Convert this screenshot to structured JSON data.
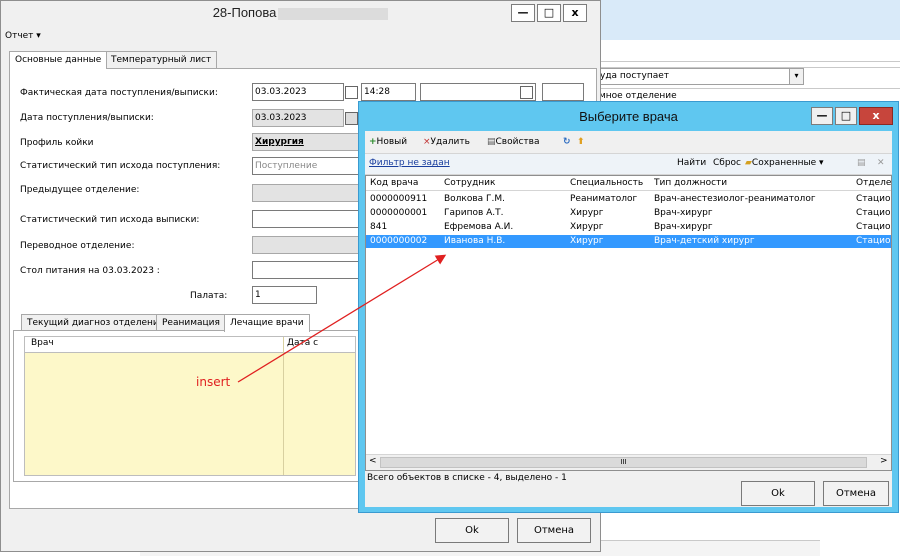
{
  "background_app": {
    "combo_value": "уда поступает",
    "row2_text": "мное отделение",
    "combo_arrow": "chevron-down-icon"
  },
  "main_window": {
    "title": "28-Попова",
    "btn_min": "—",
    "btn_max": "□",
    "btn_close": "x",
    "menu_report": "Отчет ▾",
    "tabs": [
      "Основные данные",
      "Температурный лист"
    ],
    "fields": {
      "fact_date_label": "Фактическая дата поступления/выписки:",
      "fact_date_value": "03.03.2023",
      "fact_time_value": "14:28",
      "admit_date_label": "Дата поступления/выписки:",
      "admit_date_value": "03.03.2023",
      "bed_profile_label": "Профиль койки",
      "bed_profile_value": "Хирургия",
      "stat_type_in_label": "Статистический тип исхода поступления:",
      "stat_type_in_placeholder": "Поступление",
      "prev_dept_label": "Предыдущее отделение:",
      "stat_type_out_label": "Статистический тип исхода выписки:",
      "transfer_dept_label": "Переводное отделение:",
      "diet_label": "Стол питания на 03.03.2023 :",
      "ward_label": "Палата:",
      "ward_value": "1"
    },
    "lower_tabs": [
      "Текущий диагноз отделения",
      "Реанимация",
      "Лечащие врачи"
    ],
    "grid_columns": [
      "Врач",
      "Дата с"
    ],
    "ok": "Ok",
    "cancel": "Отмена"
  },
  "dialog": {
    "title": "Выберите врача",
    "btn_min": "—",
    "btn_max": "□",
    "btn_close": "x",
    "toolbar": {
      "new": "Новый",
      "delete": "Удалить",
      "properties": "Свойства",
      "find": "Найти",
      "reset": "Сброс",
      "saved": "Сохраненные ▾",
      "close": "✕"
    },
    "filter_link": "Фильтр не задан",
    "columns": [
      "Код врача",
      "Сотрудник",
      "Специальность",
      "Тип должности",
      "Отделе"
    ],
    "rows": [
      [
        "0000000911",
        "Волкова Г.М.",
        "Реаниматолог",
        "Врач-анестезиолог-реаниматолог",
        "Стацио"
      ],
      [
        "0000000001",
        "Гарипов А.Т.",
        "Хирург",
        "Врач-хирург",
        "Стацио"
      ],
      [
        "841",
        "Ефремова А.И.",
        "Хирург",
        "Врач-хирург",
        "Стацио"
      ],
      [
        "0000000002",
        "Иванова Н.В.",
        "Хирург",
        "Врач-детский хирург",
        "Стацио"
      ]
    ],
    "selected_row": 3,
    "scroll_left": "<",
    "scroll_mid": "III",
    "scroll_right": ">",
    "status": "Всего объектов в списке - 4, выделено - 1",
    "ok": "Ok",
    "cancel": "Отмена"
  },
  "annotation": {
    "label": "insert",
    "color": "#e02020"
  }
}
